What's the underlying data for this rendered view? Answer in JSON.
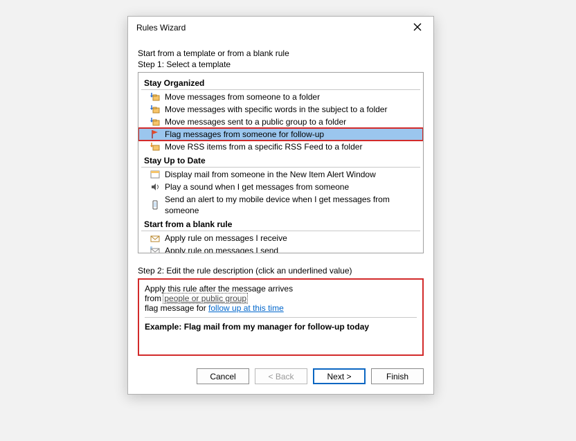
{
  "dialog": {
    "title": "Rules Wizard",
    "intro": "Start from a template or from a blank rule",
    "step1_label": "Step 1: Select a template",
    "step2_label": "Step 2: Edit the rule description (click an underlined value)"
  },
  "categories": [
    {
      "name": "Stay Organized",
      "items": [
        {
          "icon": "move-folder",
          "label": "Move messages from someone to a folder",
          "selected": false
        },
        {
          "icon": "move-folder",
          "label": "Move messages with specific words in the subject to a folder",
          "selected": false
        },
        {
          "icon": "move-folder",
          "label": "Move messages sent to a public group to a folder",
          "selected": false
        },
        {
          "icon": "flag",
          "label": "Flag messages from someone for follow-up",
          "selected": true
        },
        {
          "icon": "rss-folder",
          "label": "Move RSS items from a specific RSS Feed to a folder",
          "selected": false
        }
      ]
    },
    {
      "name": "Stay Up to Date",
      "items": [
        {
          "icon": "alert-window",
          "label": "Display mail from someone in the New Item Alert Window",
          "selected": false
        },
        {
          "icon": "sound",
          "label": "Play a sound when I get messages from someone",
          "selected": false
        },
        {
          "icon": "mobile",
          "label": "Send an alert to my mobile device when I get messages from someone",
          "selected": false
        }
      ]
    },
    {
      "name": "Start from a blank rule",
      "items": [
        {
          "icon": "envelope-in",
          "label": "Apply rule on messages I receive",
          "selected": false
        },
        {
          "icon": "envelope-out",
          "label": "Apply rule on messages I send",
          "selected": false
        }
      ]
    }
  ],
  "description": {
    "line1": "Apply this rule after the message arrives",
    "from_prefix": "from ",
    "from_link": "people or public group",
    "flag_prefix": "flag message for ",
    "flag_link": "follow up at this time",
    "example": "Example: Flag mail from my manager for follow-up today"
  },
  "buttons": {
    "cancel": "Cancel",
    "back": "< Back",
    "next": "Next >",
    "finish": "Finish"
  }
}
